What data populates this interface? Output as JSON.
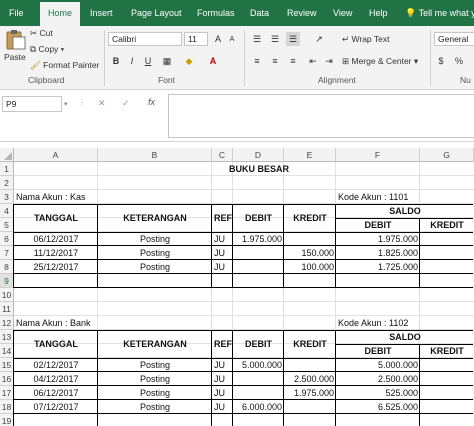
{
  "tabs": [
    "File",
    "Home",
    "Insert",
    "Page Layout",
    "Formulas",
    "Data",
    "Review",
    "View",
    "Help",
    "Tell me what you"
  ],
  "ribbon": {
    "paste": "Paste",
    "cut": "Cut",
    "copy": "Copy",
    "format_painter": "Format Painter",
    "clipboard_label": "Clipboard",
    "font_name": "Calibri",
    "font_size": "11",
    "font_label": "Font",
    "wrap_text": "Wrap Text",
    "merge_center": "Merge & Center",
    "alignment_label": "Alignment",
    "number_format": "General",
    "number_label": "Nu",
    "bold": "B",
    "italic": "I",
    "underline": "U",
    "grow": "A",
    "shrink": "A"
  },
  "formula_bar": {
    "name_box": "P9",
    "cancel": "✕",
    "confirm": "✓",
    "fx": "fx",
    "content": ""
  },
  "columns": [
    "A",
    "B",
    "C",
    "D",
    "E",
    "F",
    "G"
  ],
  "rows": [
    "1",
    "2",
    "3",
    "4",
    "5",
    "6",
    "7",
    "8",
    "9",
    "10",
    "11",
    "12",
    "13",
    "14",
    "15",
    "16",
    "17",
    "18",
    "19"
  ],
  "sheet": {
    "title": "BUKU BESAR",
    "kas": {
      "account_name": "Nama Akun : Kas",
      "account_code": "Kode Akun : 1101",
      "headers": {
        "tanggal": "TANGGAL",
        "keterangan": "KETERANGAN",
        "ref": "REF",
        "debit": "DEBIT",
        "kredit": "KREDIT",
        "saldo": "SALDO",
        "saldo_debit": "DEBIT",
        "saldo_kredit": "KREDIT"
      },
      "rows": [
        {
          "tanggal": "06/12/2017",
          "keterangan": "Posting",
          "ref": "JU",
          "debit": "1.975.000",
          "kredit": "",
          "saldo_debit": "1.975.000",
          "saldo_kredit": ""
        },
        {
          "tanggal": "11/12/2017",
          "keterangan": "Posting",
          "ref": "JU",
          "debit": "",
          "kredit": "150.000",
          "saldo_debit": "1.825.000",
          "saldo_kredit": ""
        },
        {
          "tanggal": "25/12/2017",
          "keterangan": "Posting",
          "ref": "JU",
          "debit": "",
          "kredit": "100.000",
          "saldo_debit": "1.725.000",
          "saldo_kredit": ""
        }
      ]
    },
    "bank": {
      "account_name": "Nama Akun : Bank",
      "account_code": "Kode Akun : 1102",
      "headers": {
        "tanggal": "TANGGAL",
        "keterangan": "KETERANGAN",
        "ref": "REF",
        "debit": "DEBIT",
        "kredit": "KREDIT",
        "saldo": "SALDO",
        "saldo_debit": "DEBIT",
        "saldo_kredit": "KREDIT"
      },
      "rows": [
        {
          "tanggal": "02/12/2017",
          "keterangan": "Posting",
          "ref": "JU",
          "debit": "5.000.000",
          "kredit": "",
          "saldo_debit": "5.000.000",
          "saldo_kredit": ""
        },
        {
          "tanggal": "04/12/2017",
          "keterangan": "Posting",
          "ref": "JU",
          "debit": "",
          "kredit": "2.500.000",
          "saldo_debit": "2.500.000",
          "saldo_kredit": ""
        },
        {
          "tanggal": "06/12/2017",
          "keterangan": "Posting",
          "ref": "JU",
          "debit": "",
          "kredit": "1.975.000",
          "saldo_debit": "525.000",
          "saldo_kredit": ""
        },
        {
          "tanggal": "07/12/2017",
          "keterangan": "Posting",
          "ref": "JU",
          "debit": "6.000.000",
          "kredit": "",
          "saldo_debit": "6.525.000",
          "saldo_kredit": ""
        }
      ]
    }
  },
  "colors": {
    "brand": "#217346",
    "ribbon_bg": "#f3f3f3",
    "header_bg": "#f3f3f3"
  }
}
